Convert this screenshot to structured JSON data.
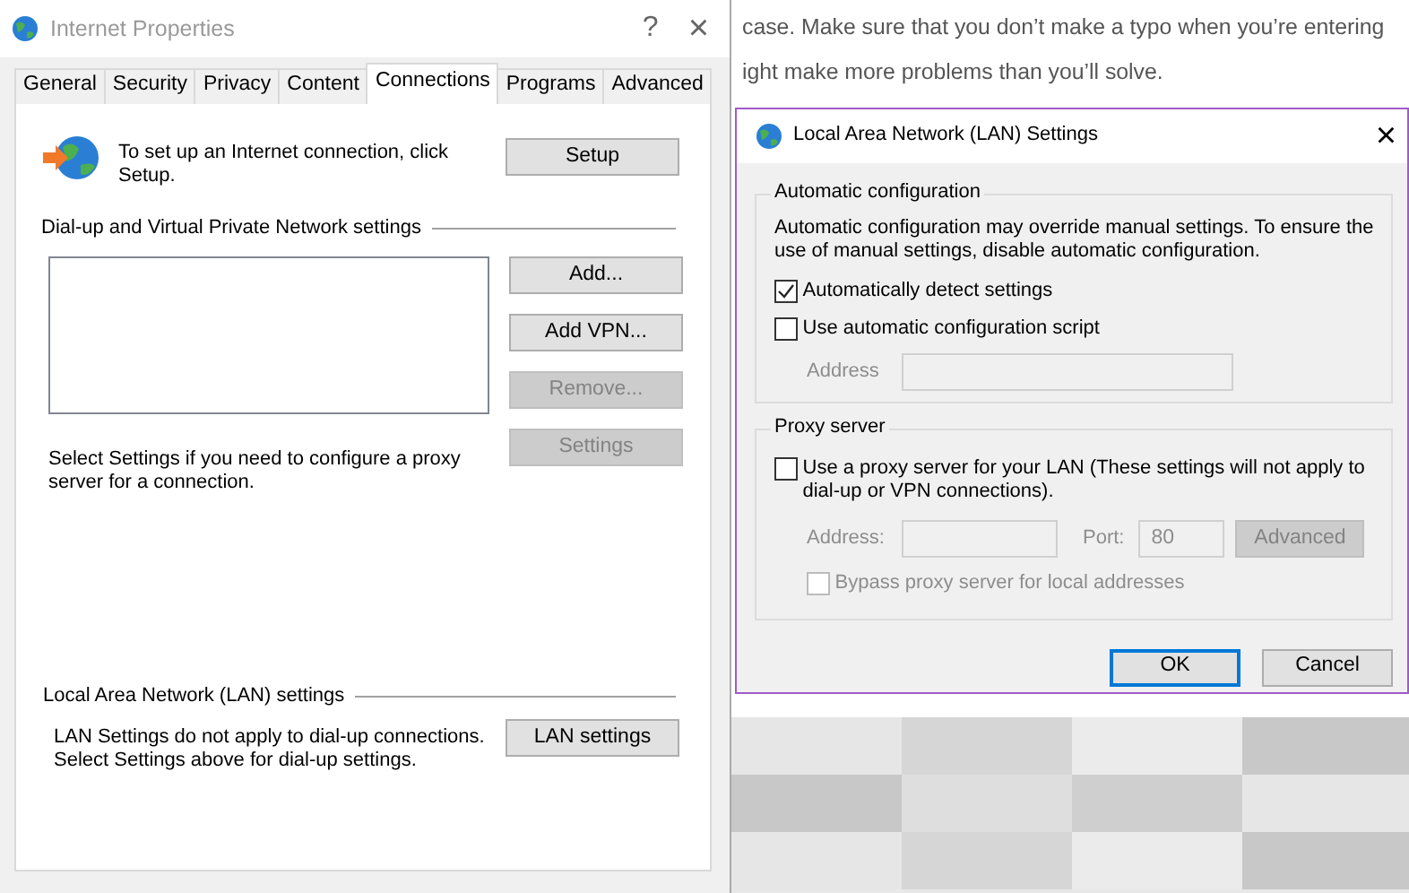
{
  "web_text": {
    "lines": [
      "case. Make sure that you don’t make a typo when you’re entering",
      "ight make more problems than you’ll solve."
    ]
  },
  "internet_properties": {
    "title": "Internet Properties",
    "help_button": "?",
    "close_button": "×",
    "tabs": [
      {
        "label": "General",
        "selected": false
      },
      {
        "label": "Security",
        "selected": false
      },
      {
        "label": "Privacy",
        "selected": false
      },
      {
        "label": "Content",
        "selected": false
      },
      {
        "label": "Connections",
        "selected": true
      },
      {
        "label": "Programs",
        "selected": false
      },
      {
        "label": "Advanced",
        "selected": false
      }
    ],
    "setup": {
      "text": "To set up an Internet connection, click\nSetup.",
      "button": "Setup"
    },
    "vpn": {
      "heading": "Dial-up and Virtual Private Network settings",
      "buttons": [
        {
          "label": "Add...",
          "disabled": false
        },
        {
          "label": "Add VPN...",
          "disabled": false
        },
        {
          "label": "Remove...",
          "disabled": true
        },
        {
          "label": "Settings",
          "disabled": true
        }
      ],
      "note": "Select Settings if you need to configure a proxy\nserver for a connection."
    },
    "lan": {
      "heading": "Local Area Network (LAN) settings",
      "note": "LAN Settings do not apply to dial-up connections.\nSelect Settings above for dial-up settings.",
      "button": "LAN settings"
    }
  },
  "lan_dialog": {
    "title": "Local Area Network (LAN) Settings",
    "close_button": "×",
    "auto_config": {
      "legend": "Automatic configuration",
      "description": "Automatic configuration may override manual settings.  To ensure the\nuse of manual settings, disable automatic configuration.",
      "options": [
        {
          "label": "Automatically detect settings",
          "checked": true
        },
        {
          "label": "Use automatic configuration script",
          "checked": false
        }
      ],
      "address_label": "Address",
      "address_disabled": true
    },
    "proxy": {
      "legend": "Proxy server",
      "use_proxy": {
        "label": "Use a proxy server for your LAN (These settings will not apply to\ndial-up or VPN connections).",
        "checked": false
      },
      "disabled": true,
      "address_label": "Address:",
      "port_label": "Port:",
      "port_value": "80",
      "advanced_button": "Advanced",
      "bypass": {
        "label": "Bypass proxy server for local addresses",
        "checked": false
      }
    },
    "buttons": [
      {
        "label": "OK",
        "default": true
      },
      {
        "label": "Cancel",
        "default": false
      }
    ]
  }
}
